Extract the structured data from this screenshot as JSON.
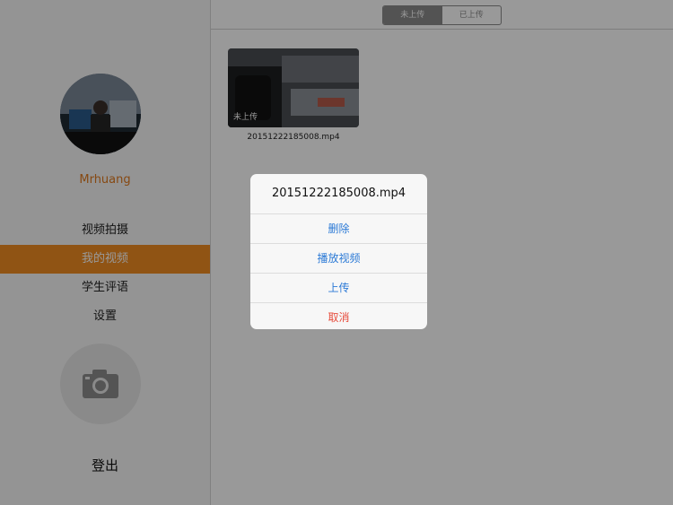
{
  "sidebar": {
    "username": "Mrhuang",
    "menu": [
      {
        "label": "视频拍摄"
      },
      {
        "label": "我的视频",
        "active": true
      },
      {
        "label": "学生评语"
      },
      {
        "label": "设置"
      }
    ],
    "camera_icon": "camera-icon",
    "logout_label": "登出"
  },
  "topbar": {
    "tabs": [
      {
        "label": "未上传",
        "active": true
      },
      {
        "label": "已上传"
      }
    ]
  },
  "videos": [
    {
      "status_tag": "未上传",
      "filename": "20151222185008.mp4"
    }
  ],
  "action_sheet": {
    "title": "20151222185008.mp4",
    "items": [
      "删除",
      "播放视频",
      "上传",
      "取消"
    ]
  },
  "colors": {
    "accent": "#f08c22",
    "action_text": "#2c7ad6",
    "cancel_text": "#e74c3c"
  }
}
